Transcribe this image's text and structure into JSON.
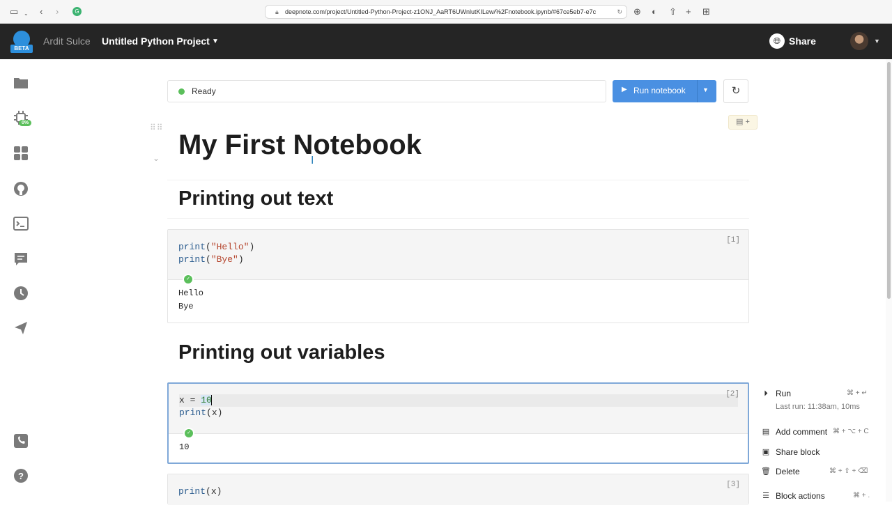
{
  "browser": {
    "url": "deepnote.com/project/Untitled-Python-Project-z1ONJ_AaRT6UWnlutKILew/%2Fnotebook.ipynb/#67ce5eb7-e7c"
  },
  "header": {
    "logo_badge": "BETA",
    "user_name": "Ardit Sulce",
    "project_name": "Untitled Python Project",
    "share_label": "Share"
  },
  "sidebar": {
    "cpu_badge": "0%",
    "icons": [
      "folder-icon",
      "cpu-icon",
      "apps-icon",
      "github-icon",
      "terminal-icon",
      "comments-icon",
      "history-icon",
      "publish-icon",
      "phone-icon",
      "help-icon"
    ]
  },
  "toolbar": {
    "status_text": "Ready",
    "run_label": "Run notebook",
    "status_color": "#5bbf5b",
    "accent_color": "#4a90e2"
  },
  "notebook": {
    "title": "My First Notebook",
    "section1": "Printing out text",
    "section2": "Printing out variables",
    "cell1": {
      "number": "[1]",
      "line1_fn": "print",
      "line1_arg": "\"Hello\"",
      "line2_fn": "print",
      "line2_arg": "\"Bye\"",
      "output": [
        "Hello",
        "Bye"
      ]
    },
    "cell2": {
      "number": "[2]",
      "line1_var": "x = ",
      "line1_val": "10",
      "line2_fn": "print",
      "line2_arg": "x",
      "output": "10"
    },
    "cell3": {
      "number": "[3]",
      "line1_fn": "print",
      "line1_arg": "x"
    }
  },
  "context_menu": {
    "run": "Run",
    "run_kbd": "⌘ + ↵",
    "last_run": "Last run: 11:38am, 10ms",
    "add_comment": "Add comment",
    "add_comment_kbd": "⌘ + ⌥ + C",
    "share_block": "Share block",
    "delete": "Delete",
    "delete_kbd": "⌘ + ⇧ + ⌫",
    "block_actions": "Block actions",
    "block_actions_kbd": "⌘ + ."
  }
}
